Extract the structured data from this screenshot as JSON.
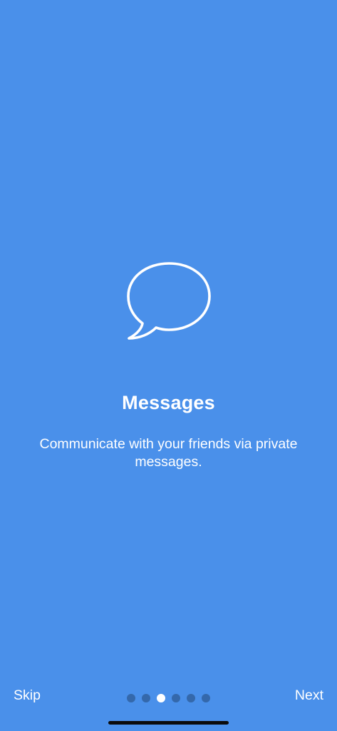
{
  "theme": {
    "background": "#4a90ea",
    "text": "#ffffff",
    "dot_inactive": "#3468ab",
    "dot_active": "#ffffff",
    "home_indicator": "#0b0b0b"
  },
  "onboarding": {
    "icon": "speech-bubble-icon",
    "title": "Messages",
    "description": "Communicate with your friends via private messages."
  },
  "navigation": {
    "skip_label": "Skip",
    "next_label": "Next",
    "page_count": 6,
    "current_page": 3
  }
}
